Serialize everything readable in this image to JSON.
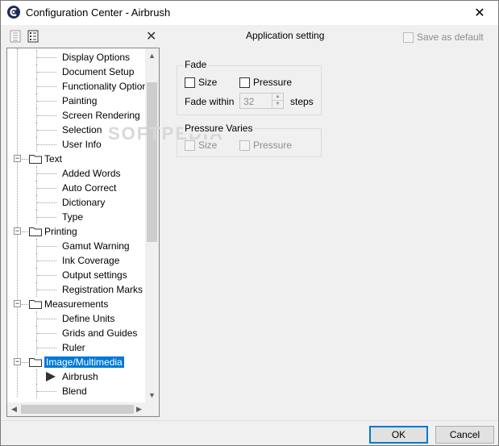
{
  "window": {
    "title": "Configuration Center - Airbrush",
    "close_glyph": "✕"
  },
  "toolbar": {
    "section_title": "Application setting",
    "save_default_label": "Save as default",
    "clear_glyph": "✕"
  },
  "tree": {
    "rows": [
      {
        "label": "Display Options",
        "level": 2
      },
      {
        "label": "Document Setup",
        "level": 2
      },
      {
        "label": "Functionality Options",
        "level": 2
      },
      {
        "label": "Painting",
        "level": 2
      },
      {
        "label": "Screen Rendering",
        "level": 2
      },
      {
        "label": "Selection",
        "level": 2
      },
      {
        "label": "User Info",
        "level": 2
      },
      {
        "label": "Text",
        "level": 1
      },
      {
        "label": "Added Words",
        "level": 2
      },
      {
        "label": "Auto Correct",
        "level": 2
      },
      {
        "label": "Dictionary",
        "level": 2
      },
      {
        "label": "Type",
        "level": 2
      },
      {
        "label": "Printing",
        "level": 1
      },
      {
        "label": "Gamut Warning",
        "level": 2
      },
      {
        "label": "Ink Coverage",
        "level": 2
      },
      {
        "label": "Output settings",
        "level": 2
      },
      {
        "label": "Registration Marks",
        "level": 2
      },
      {
        "label": "Measurements",
        "level": 1
      },
      {
        "label": "Define Units",
        "level": 2
      },
      {
        "label": "Grids and Guides",
        "level": 2
      },
      {
        "label": "Ruler",
        "level": 2
      },
      {
        "label": "Image/Multimedia",
        "level": 1
      },
      {
        "label": "Airbrush",
        "level": 2
      },
      {
        "label": "Blend",
        "level": 2
      }
    ],
    "expander_glyph": "−"
  },
  "fade": {
    "title": "Fade",
    "size_label": "Size",
    "pressure_label": "Pressure",
    "fade_within_label": "Fade within",
    "fade_within_value": "32",
    "steps_label": "steps"
  },
  "pressure_varies": {
    "title": "Pressure Varies",
    "size_label": "Size",
    "pressure_label": "Pressure"
  },
  "watermark": "SOFTPEDIA",
  "buttons": {
    "ok": "OK",
    "cancel": "Cancel"
  },
  "colors": {
    "selection": "#0078d7",
    "app_icon": "#1e2a55"
  }
}
